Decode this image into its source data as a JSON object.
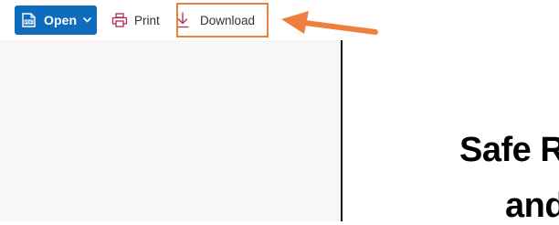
{
  "toolbar": {
    "open_label": "Open",
    "print_label": "Print",
    "download_label": "Download",
    "accent_color": "#0f6cbd"
  },
  "icons": {
    "open": "pdf-file-icon",
    "open_menu": "chevron-down-icon",
    "print": "printer-icon",
    "download": "download-arrow-icon"
  },
  "annotation": {
    "color": "#ef7f3c",
    "highlighted_item": "Download",
    "arrow": "arrow-left-icon"
  },
  "document": {
    "title_line1": "Safe R",
    "title_line2": "and"
  }
}
